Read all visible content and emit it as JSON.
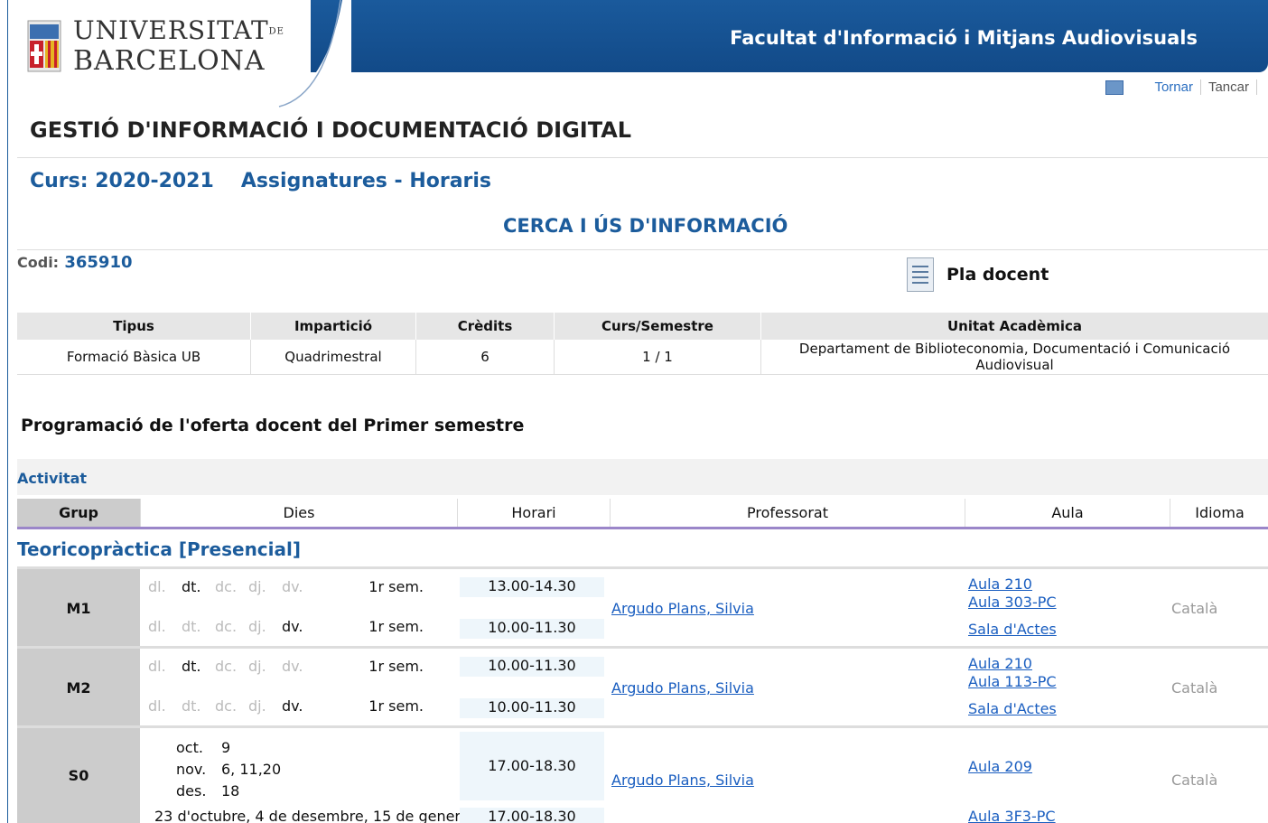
{
  "header": {
    "logo_line1": "UNIVERSITAT",
    "logo_de": "DE",
    "logo_line2": "BARCELONA",
    "faculty": "Facultat d'Informació i Mitjans Audiovisuals",
    "nav_back": "Tornar",
    "nav_close": "Tancar"
  },
  "page": {
    "title": "GESTIÓ D'INFORMACIÓ I DOCUMENTACIÓ DIGITAL",
    "curs": "Curs: 2020-2021",
    "section": "Assignatures - Horaris",
    "subject": "CERCA I ÚS D'INFORMACIÓ",
    "codi_label": "Codi:",
    "codi": "365910",
    "pla": "Pla docent"
  },
  "info": {
    "headers": [
      "Tipus",
      "Impartició",
      "Crèdits",
      "Curs/Semestre",
      "Unitat Acadèmica"
    ],
    "row": [
      "Formació Bàsica UB",
      "Quadrimestral",
      "6",
      "1 / 1",
      "Departament de Biblioteconomia, Documentació i Comunicació Audiovisual"
    ]
  },
  "schedule": {
    "heading": "Programació de l'oferta docent del Primer semestre",
    "activity_label": "Activitat",
    "columns": [
      "Grup",
      "Dies",
      "Horari",
      "Professorat",
      "Aula",
      "Idioma"
    ],
    "category": "Teoricopràctica [Presencial]",
    "days": [
      "dl.",
      "dt.",
      "dc.",
      "dj.",
      "dv."
    ],
    "groups": [
      {
        "name": "M1",
        "rows": [
          {
            "active": "dt.",
            "sem": "1r sem.",
            "time": "13.00-14.30"
          },
          {
            "active": "dv.",
            "sem": "1r sem.",
            "time": "10.00-11.30"
          }
        ],
        "prof": "Argudo Plans, Silvia",
        "aula": [
          "Aula 210",
          "Aula 303-PC",
          "Sala d'Actes"
        ],
        "lang": "Català"
      },
      {
        "name": "M2",
        "rows": [
          {
            "active": "dt.",
            "sem": "1r sem.",
            "time": "10.00-11.30"
          },
          {
            "active": "dv.",
            "sem": "1r sem.",
            "time": "10.00-11.30"
          }
        ],
        "prof": "Argudo Plans, Silvia",
        "aula": [
          "Aula 210",
          "Aula 113-PC",
          "Sala d'Actes"
        ],
        "lang": "Català"
      },
      {
        "name": "S0",
        "dates": [
          {
            "month": "oct.",
            "days": "9"
          },
          {
            "month": "nov.",
            "days": "6, 11,20"
          },
          {
            "month": "des.",
            "days": "18"
          }
        ],
        "time1": "17.00-18.30",
        "extra": "23 d'octubre, 4 de desembre, 15 de gener.",
        "time2": "17.00-18.30",
        "prof": "Argudo Plans, Silvia",
        "aula": [
          "Aula 209",
          "Aula 3F3-PC"
        ],
        "lang": "Català"
      }
    ]
  }
}
